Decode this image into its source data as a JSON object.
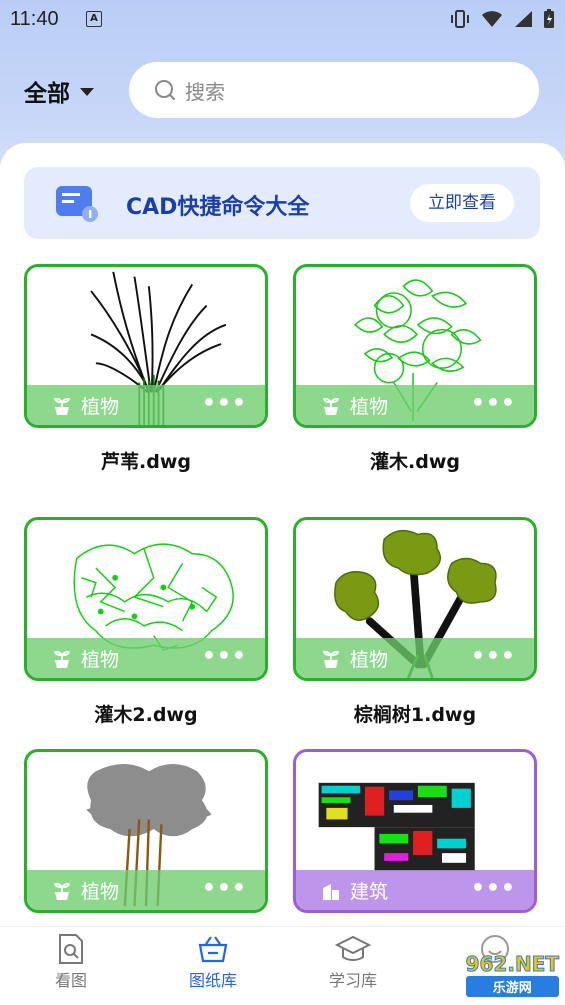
{
  "status_bar": {
    "time": "11:40",
    "notification_icon": "A"
  },
  "header": {
    "filter_label": "全部",
    "search_placeholder": "搜索"
  },
  "banner": {
    "title": "CAD快捷命令大全",
    "button_label": "立即查看"
  },
  "files": [
    {
      "name": "芦苇.dwg",
      "category": "植物"
    },
    {
      "name": "灌木.dwg",
      "category": "植物"
    },
    {
      "name": "灌木2.dwg",
      "category": "植物"
    },
    {
      "name": "棕榈树1.dwg",
      "category": "植物"
    },
    {
      "name": "",
      "category": "植物"
    },
    {
      "name": "",
      "category": "建筑"
    }
  ],
  "more_glyph": "•••",
  "bottom_nav": [
    {
      "label": "看图",
      "icon": "document-search-icon",
      "active": false
    },
    {
      "label": "图纸库",
      "icon": "basket-icon",
      "active": true
    },
    {
      "label": "学习库",
      "icon": "graduation-cap-icon",
      "active": false
    },
    {
      "label": "",
      "icon": "profile-icon",
      "active": false
    }
  ],
  "watermark": {
    "brand": "962.NET",
    "sub": "乐游网"
  },
  "colors": {
    "accent": "#2563eb",
    "plant_border": "#27b12b",
    "building_border": "#9c5ddb",
    "banner_text": "#1b3fa8"
  }
}
